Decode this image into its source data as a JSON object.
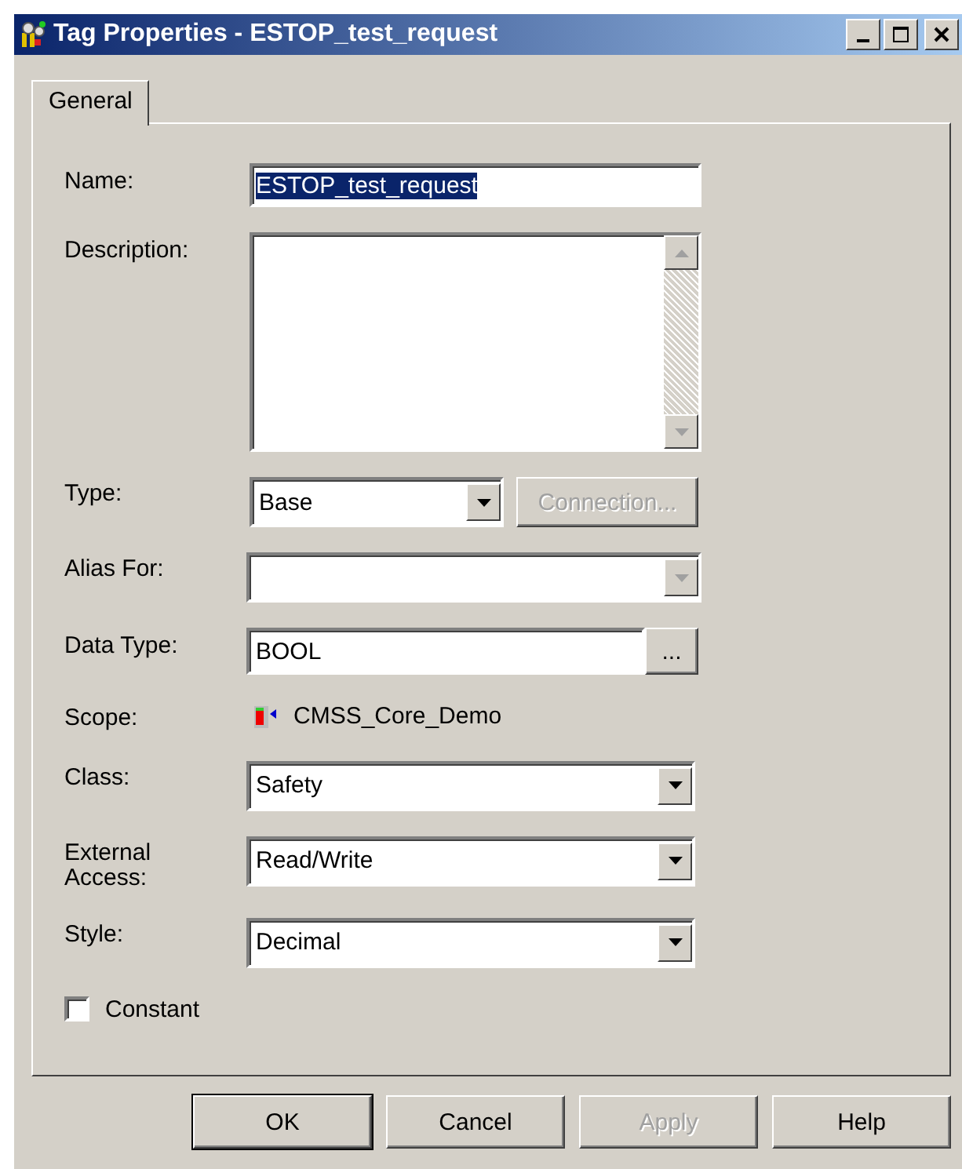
{
  "window": {
    "title": "Tag Properties - ESTOP_test_request"
  },
  "tabs": [
    {
      "label": "General",
      "selected": true
    }
  ],
  "fields": [
    {
      "kind": "text",
      "label": "Name:",
      "value": "ESTOP_test_request",
      "highlighted": true
    },
    {
      "kind": "textarea",
      "label": "Description:"
    },
    {
      "kind": "combo",
      "label": "Type:",
      "value": "Base",
      "disabled": false,
      "button": {
        "label": "Connection...",
        "disabled": true
      }
    },
    {
      "kind": "combo",
      "label": "Alias For:",
      "disabled": true
    },
    {
      "kind": "browse",
      "label": "Data Type:",
      "value": "BOOL",
      "button": {
        "label": "...",
        "disabled": false
      }
    },
    {
      "kind": "scope",
      "label": "Scope:",
      "value": "CMSS_Core_Demo"
    },
    {
      "kind": "combo",
      "label": "Class:",
      "value": "Safety",
      "disabled": false
    },
    {
      "kind": "combo",
      "label": "External Access:",
      "value": "Read/Write",
      "disabled": false
    },
    {
      "kind": "combo",
      "label": "Style:",
      "value": "Decimal",
      "disabled": false
    }
  ],
  "constant": {
    "label": "Constant",
    "checked": false
  },
  "buttons": [
    {
      "label": "OK",
      "default": true,
      "disabled": false
    },
    {
      "label": "Cancel",
      "default": false,
      "disabled": false
    },
    {
      "label": "Apply",
      "default": false,
      "disabled": true
    },
    {
      "label": "Help",
      "default": false,
      "disabled": false
    }
  ]
}
